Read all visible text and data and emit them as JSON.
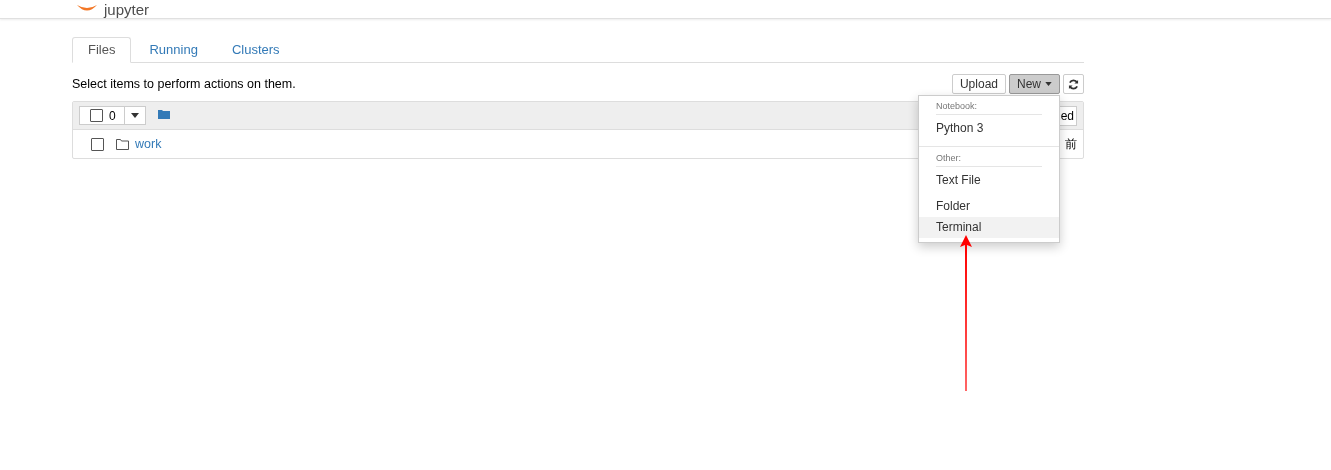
{
  "header": {
    "logo": "jupyter"
  },
  "tabs": [
    {
      "label": "Files",
      "selected": true
    },
    {
      "label": "Running",
      "selected": false
    },
    {
      "label": "Clusters",
      "selected": false
    }
  ],
  "hint": "Select items to perform actions on them.",
  "buttons": {
    "upload": "Upload",
    "new": "New"
  },
  "list_header": {
    "checked": false,
    "count": "0",
    "sort_button": "ed"
  },
  "rows": [
    {
      "name": "work",
      "checked": false,
      "column_2": "前"
    }
  ],
  "menu": {
    "sections": [
      {
        "heading": "Notebook:",
        "items": [
          {
            "label": "Python 3",
            "selected": false
          }
        ]
      },
      {
        "heading": "Other:",
        "items": [
          {
            "label": "Text File",
            "selected": false
          },
          {
            "label": "Folder",
            "selected": false
          },
          {
            "label": "Terminal",
            "selected": true
          }
        ]
      }
    ]
  }
}
